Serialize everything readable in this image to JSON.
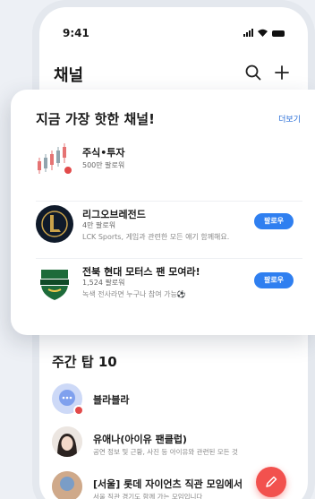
{
  "status": {
    "time": "9:41"
  },
  "header": {
    "title": "채널"
  },
  "hot_channels": {
    "title": "지금 가장 핫한 채널!",
    "more_label": "더보기",
    "items": [
      {
        "name": "주식•투자",
        "followers": "500만 팔로워",
        "description": "",
        "button": ""
      },
      {
        "name": "리그오브레전드",
        "followers": "4만 팔로워",
        "description": "LCK Sports, 게임과 관련한 모든 얘기 함께해요.",
        "button": "팔로우"
      },
      {
        "name": "전북 현대 모터스 팬 모여라!",
        "followers": "1,524 팔로워",
        "description": "녹색 전사라면 누구나 참여 가능⚽",
        "button": "팔로우"
      }
    ]
  },
  "weekly_top": {
    "title": "주간 탑 10",
    "items": [
      {
        "name": "블라블라",
        "description": ""
      },
      {
        "name": "유애나(아이유 팬클럽)",
        "description": "공연 정보 및 근황, 사진 등 아이유와 관련된 모든 것"
      },
      {
        "name": "[서울] 롯데 자이언츠 직관 모임에서",
        "description": "서울 직관 경기도 함께 가는 모임입니다"
      }
    ]
  },
  "colors": {
    "accent": "#2f7ff0",
    "fab": "#f2514e",
    "badge": "#e24a4a"
  }
}
